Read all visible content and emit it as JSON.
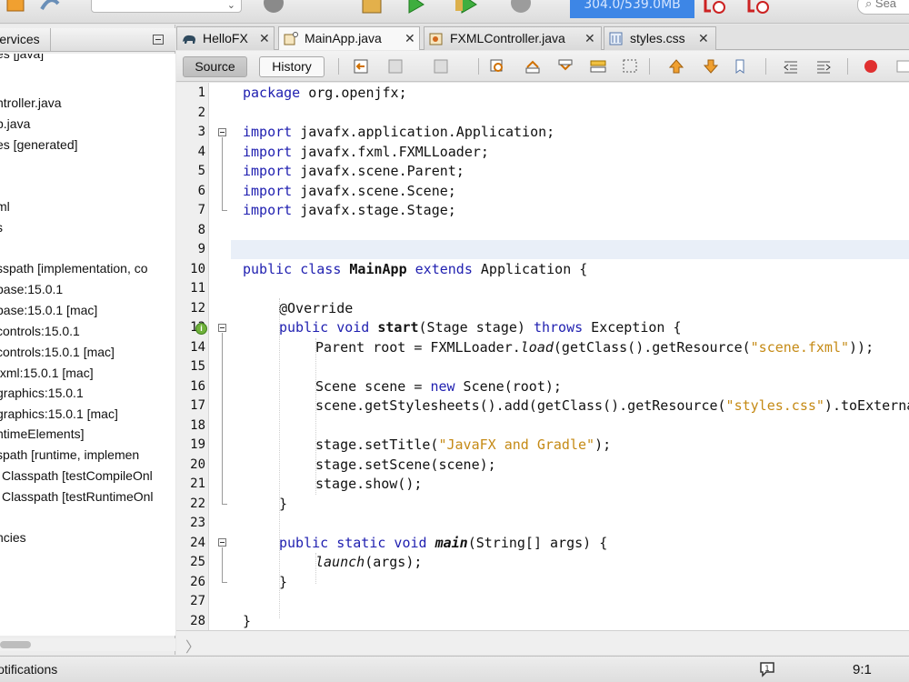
{
  "toolbar": {
    "memory": "304.0/539.0MB",
    "search_placeholder": "Sea"
  },
  "left_panel": {
    "tab_label": "Services",
    "tree": [
      "es [java]",
      "ntroller.java",
      "p.java",
      "es [generated]",
      "ml",
      "s",
      "sspath [implementation, co",
      "base:15.0.1",
      "base:15.0.1 [mac]",
      "controls:15.0.1",
      "controls:15.0.1 [mac]",
      "fxml:15.0.1 [mac]",
      "graphics:15.0.1",
      "graphics:15.0.1 [mac]",
      "ntimeElements]",
      "spath [runtime, implemen",
      "Classpath [testCompileOnl",
      "Classpath [testRuntimeOnl",
      "ncies"
    ]
  },
  "tabs": [
    {
      "label": "HelloFX",
      "icon": "gradle-elephant-icon"
    },
    {
      "label": "MainApp.java",
      "icon": "java-file-icon"
    },
    {
      "label": "FXMLController.java",
      "icon": "java-file-icon"
    },
    {
      "label": "styles.css",
      "icon": "css-file-icon"
    }
  ],
  "editor_toolbar": {
    "source_label": "Source",
    "history_label": "History"
  },
  "editor": {
    "line_numbers": [
      "1",
      "2",
      "3",
      "4",
      "5",
      "6",
      "7",
      "8",
      "9",
      "10",
      "11",
      "12",
      "13",
      "14",
      "15",
      "16",
      "17",
      "18",
      "19",
      "20",
      "21",
      "22",
      "23",
      "24",
      "25",
      "26",
      "27",
      "28"
    ],
    "code": {
      "l1_kw": "package",
      "l1_rest": " org.openjfx;",
      "l3_kw": "import",
      "l3_rest": " javafx.application.Application;",
      "l4_kw": "import",
      "l4_rest": " javafx.fxml.FXMLLoader;",
      "l5_kw": "import",
      "l5_rest": " javafx.scene.Parent;",
      "l6_kw": "import",
      "l6_rest": " javafx.scene.Scene;",
      "l7_kw": "import",
      "l7_rest": " javafx.stage.Stage;",
      "l10_kw1": "public class",
      "l10_name": "MainApp",
      "l10_kw2": "extends",
      "l10_rest": " Application {",
      "l12": "@Override",
      "l13_kw": "public void",
      "l13_name": "start",
      "l13_mid": "(Stage stage) ",
      "l13_kw2": "throws",
      "l13_rest": " Exception {",
      "l14_a": "Parent root = FXMLLoader.",
      "l14_it": "load",
      "l14_b": "(getClass().getResource(",
      "l14_str": "\"scene.fxml\"",
      "l14_c": "));",
      "l16_a": "Scene scene = ",
      "l16_kw": "new",
      "l16_b": " Scene(root);",
      "l17_a": "scene.getStylesheets().add(getClass().getResource(",
      "l17_str": "\"styles.css\"",
      "l17_b": ").toExternalForm());",
      "l19_a": "stage.setTitle(",
      "l19_str": "\"JavaFX and Gradle\"",
      "l19_b": ");",
      "l20": "stage.setScene(scene);",
      "l21": "stage.show();",
      "l22": "}",
      "l24_kw": "public static void",
      "l24_name": "main",
      "l24_rest": "(String[] args) {",
      "l25_it": "launch",
      "l25_rest": "(args);",
      "l26": "}",
      "l28": "}"
    }
  },
  "statusbar": {
    "left_text": "Notifications",
    "caret": "9:1"
  }
}
